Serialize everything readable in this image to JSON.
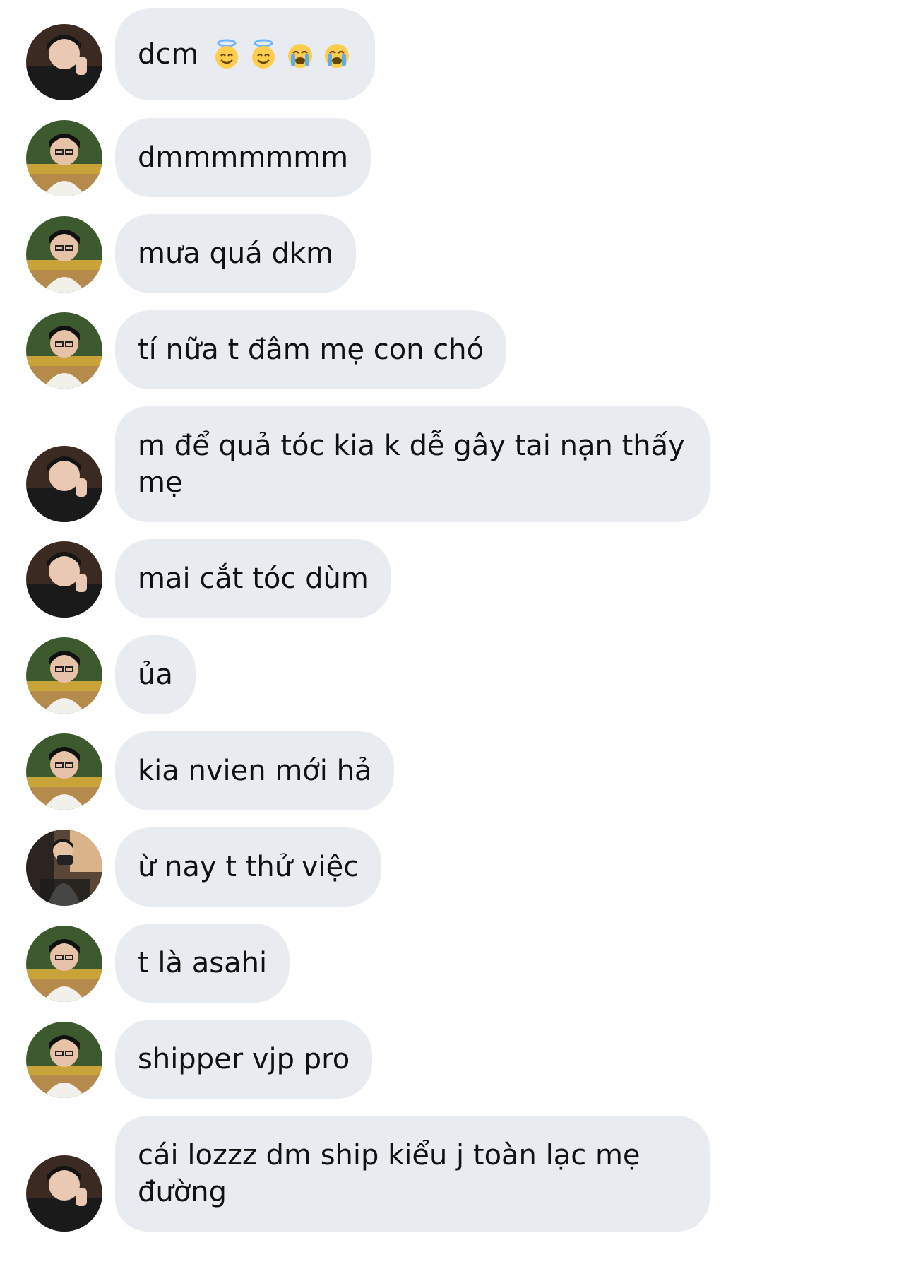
{
  "messages": [
    {
      "text": "dcm",
      "emojis": [
        "smiling-halo-emoji",
        "smiling-halo-emoji",
        "loudly-crying-emoji",
        "loudly-crying-emoji"
      ],
      "avatar": "avatar-a"
    },
    {
      "text": "dmmmmmmm",
      "avatar": "avatar-b"
    },
    {
      "text": "mưa quá dkm",
      "avatar": "avatar-b"
    },
    {
      "text": "tí nữa t đâm mẹ con chó",
      "avatar": "avatar-b"
    },
    {
      "text": "m để quả tóc kia k dễ gây tai nạn thấy mẹ",
      "avatar": "avatar-a"
    },
    {
      "text": "mai cắt tóc dùm",
      "avatar": "avatar-a"
    },
    {
      "text": "ủa",
      "avatar": "avatar-b"
    },
    {
      "text": "kia nvien mới hả",
      "avatar": "avatar-b"
    },
    {
      "text": "ừ nay t thử việc",
      "avatar": "avatar-c"
    },
    {
      "text": "t là asahi",
      "avatar": "avatar-b"
    },
    {
      "text": "shipper vjp pro",
      "avatar": "avatar-b"
    },
    {
      "text": "cái lozzz dm ship kiểu j toàn lạc mẹ đường",
      "avatar": "avatar-a"
    }
  ],
  "colors": {
    "bubble_bg": "#e8ecf1",
    "text": "#111111",
    "background": "#ffffff"
  }
}
